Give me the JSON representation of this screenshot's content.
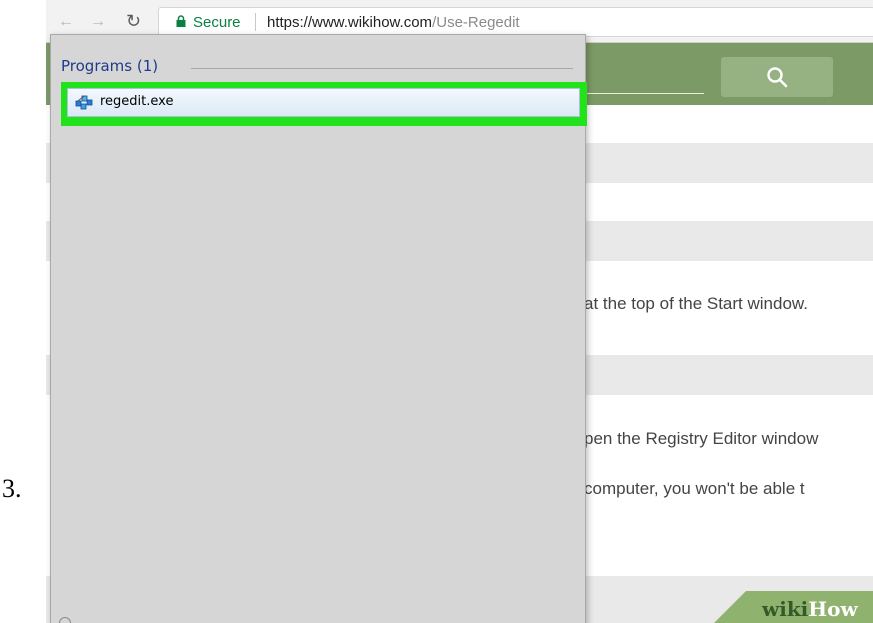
{
  "step": {
    "number": "3."
  },
  "browser": {
    "secure_label": "Secure",
    "url_host": "https://www.wikihow.com",
    "url_path": "/Use-Regedit",
    "back_icon": "back-arrow-icon",
    "forward_icon": "forward-arrow-icon",
    "reload_icon": "reload-icon",
    "lock_icon": "lock-icon"
  },
  "page": {
    "search_icon": "search-icon",
    "text_lines": [
      "at the top of the Start window.",
      "pen the Registry Editor window",
      "computer, you won't be able t"
    ],
    "logo": {
      "wiki": "wiki",
      "how": "How"
    }
  },
  "start_menu": {
    "section_header": "Programs (1)",
    "results": [
      {
        "label": "regedit.exe",
        "icon": "regedit-icon",
        "highlighted": true
      }
    ]
  },
  "colors": {
    "highlight": "#22e31b",
    "header_green": "#7c9a66",
    "secure_green": "#0b8043",
    "programs_header": "#1f3b8a"
  }
}
